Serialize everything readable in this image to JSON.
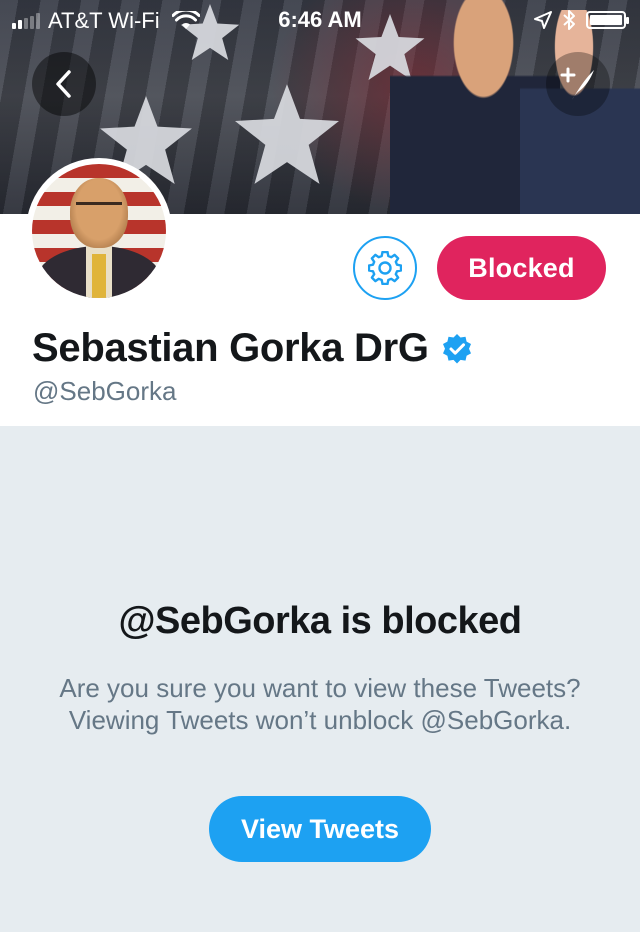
{
  "status_bar": {
    "carrier": "AT&T Wi-Fi",
    "time": "6:46 AM",
    "signal_bars_filled": 2,
    "signal_bars_total": 5,
    "icons": [
      "wifi-icon",
      "location-arrow-icon",
      "bluetooth-icon",
      "battery-icon"
    ]
  },
  "header": {
    "back_icon": "chevron-left-icon",
    "compose_icon": "compose-tweet-icon"
  },
  "profile": {
    "display_name": "Sebastian Gorka DrG",
    "handle": "@SebGorka",
    "verified_icon": "verified-badge-icon",
    "settings_icon": "gear-icon",
    "blocked_label": "Blocked"
  },
  "blocked_notice": {
    "title": "@SebGorka is blocked",
    "description": "Are you sure you want to view these Tweets? Viewing Tweets won’t unblock @SebGorka.",
    "view_button": "View Tweets"
  },
  "colors": {
    "accent_blue": "#1da1f2",
    "blocked_red": "#e0245e",
    "panel_gray": "#e6ecf0",
    "secondary_text": "#657786"
  }
}
